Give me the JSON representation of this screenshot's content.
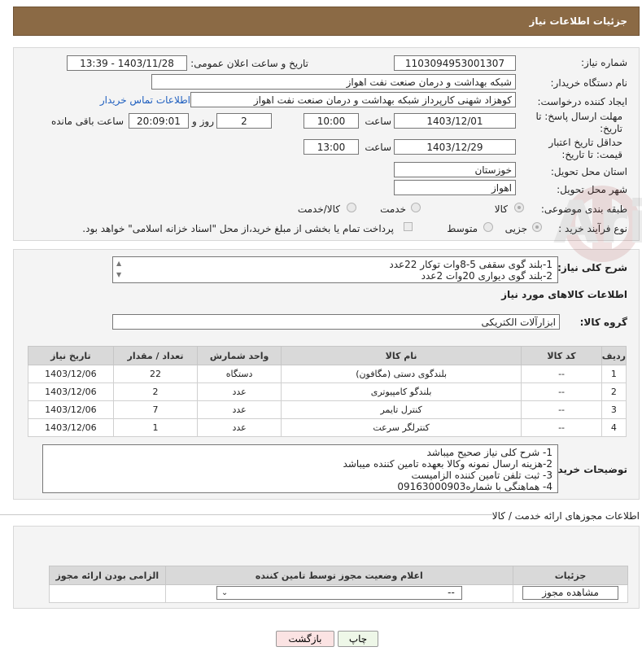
{
  "header": {
    "title": "جزئیات اطلاعات نیاز"
  },
  "fields": {
    "need_number_label": "شماره نیاز:",
    "need_number": "1103094953001307",
    "announce_label": "تاریخ و ساعت اعلان عمومی:",
    "announce_value": "1403/11/28 - 13:39",
    "buyer_org_label": "نام دستگاه خریدار:",
    "buyer_org": "شبکه بهداشت و درمان صنعت نفت اهواز",
    "creator_label": "ایجاد کننده درخواست:",
    "creator": "کوهزاد شهنی کارپرداز شبکه بهداشت و درمان صنعت نفت اهواز",
    "contact_link": "اطلاعات تماس خریدار",
    "reply_deadline_label": "مهلت ارسال پاسخ: تا تاریخ:",
    "reply_date": "1403/12/01",
    "time_label": "ساعت",
    "reply_time": "10:00",
    "days_value": "2",
    "days_label": "روز و",
    "remaining_time": "20:09:01",
    "remaining_label": "ساعت باقی مانده",
    "validity_label": "حداقل تاریخ اعتبار قیمت: تا تاریخ:",
    "validity_date": "1403/12/29",
    "validity_time": "13:00",
    "province_label": "استان محل تحویل:",
    "province": "خوزستان",
    "city_label": "شهر محل تحویل:",
    "city": "اهواز",
    "category_label": "طبقه بندی موضوعی:",
    "category_options": [
      "کالا",
      "خدمت",
      "کالا/خدمت"
    ],
    "process_label": "نوع فرآیند خرید :",
    "process_options": [
      "جزیی",
      "متوسط"
    ],
    "payment_note": "پرداخت تمام یا بخشی از مبلغ خرید،از محل \"اسناد خزانه اسلامی\" خواهد بود."
  },
  "description": {
    "label": "شرح کلی نیاز:",
    "lines": [
      "1-بلند گوی سقفی 5-8وات توکار 22عدد",
      "2-بلند گوی دیواری 20وات 2عدد"
    ]
  },
  "goods": {
    "section_title": "اطلاعات کالاهای مورد نیاز",
    "group_label": "گروه کالا:",
    "group_value": "ابزارآلات الکتریکی",
    "columns": [
      "ردیف",
      "کد کالا",
      "نام کالا",
      "واحد شمارش",
      "تعداد / مقدار",
      "تاریخ نیاز"
    ],
    "rows": [
      [
        "1",
        "--",
        "بلندگوی دستی (مگافون)",
        "دستگاه",
        "22",
        "1403/12/06"
      ],
      [
        "2",
        "--",
        "بلندگو کامپیوتری",
        "عدد",
        "2",
        "1403/12/06"
      ],
      [
        "3",
        "--",
        "کنترل تایمر",
        "عدد",
        "7",
        "1403/12/06"
      ],
      [
        "4",
        "--",
        "کنترلگر سرعت",
        "عدد",
        "1",
        "1403/12/06"
      ]
    ]
  },
  "buyer_notes": {
    "label": "توضیحات خریدار:",
    "lines": [
      "1- شرح کلی نیاز صحیح میباشد",
      "2-هزینه ارسال نمونه وکالا بعهده تامین کننده میباشد",
      "3- ثبت تلفن تامین کننده الزامیست",
      "4- هماهنگی با شماره09163000903"
    ]
  },
  "permits": {
    "section_title": "اطلاعات مجوزهای ارائه خدمت / کالا",
    "columns": [
      "الزامی بودن ارائه مجوز",
      "اعلام وضعیت مجوز توسط تامین کننده",
      "جزئیات"
    ],
    "select_value": "--",
    "view_button": "مشاهده مجوز"
  },
  "actions": {
    "print": "چاپ",
    "back": "بازگشت"
  },
  "watermark": {
    "text": "AriaTender.net"
  }
}
